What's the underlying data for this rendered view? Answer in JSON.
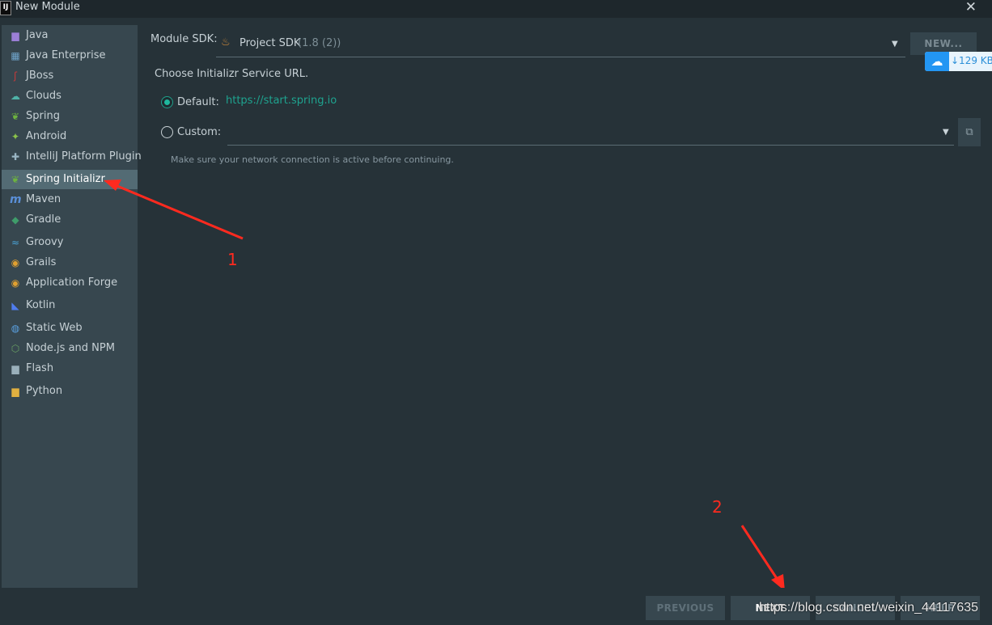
{
  "window": {
    "title": "New Module",
    "close_glyph": "✕",
    "app_icon_letter": "IJ"
  },
  "sidebar": {
    "items": [
      {
        "label": "Java",
        "icon": "folder-icon",
        "color": "#9b7fd6"
      },
      {
        "label": "Java Enterprise",
        "icon": "grid-icon",
        "color": "#6fa3c9"
      },
      {
        "label": "JBoss",
        "icon": "jboss-icon",
        "color": "#c83a3a"
      },
      {
        "label": "Clouds",
        "icon": "cloud-icon",
        "color": "#4fb3a8"
      },
      {
        "label": "Spring",
        "icon": "leaf-icon",
        "color": "#6db33f"
      },
      {
        "label": "Android",
        "icon": "android-icon",
        "color": "#8bc34a"
      },
      {
        "label": "IntelliJ Platform Plugin",
        "icon": "puzzle-icon",
        "color": "#9ab6c4"
      },
      {
        "label": "Spring Initializr",
        "icon": "spring-initializr-icon",
        "color": "#6db33f",
        "selected": true
      },
      {
        "label": "Maven",
        "icon": "maven-icon",
        "color": "#5a8fd8"
      },
      {
        "label": "Gradle",
        "icon": "gradle-icon",
        "color": "#3f9c6a"
      },
      {
        "label": "Groovy",
        "icon": "groovy-icon",
        "color": "#4aa3d6"
      },
      {
        "label": "Grails",
        "icon": "grails-icon",
        "color": "#e0a030"
      },
      {
        "label": "Application Forge",
        "icon": "forge-icon",
        "color": "#e0a030"
      },
      {
        "label": "Kotlin",
        "icon": "kotlin-icon",
        "color": "#4f7df0"
      },
      {
        "label": "Static Web",
        "icon": "globe-icon",
        "color": "#5aa0e0"
      },
      {
        "label": "Node.js and NPM",
        "icon": "nodejs-icon",
        "color": "#68a063"
      },
      {
        "label": "Flash",
        "icon": "flash-icon",
        "color": "#9ab0bb"
      },
      {
        "label": "Python",
        "icon": "python-folder-icon",
        "color": "#e0b040"
      }
    ]
  },
  "sdk": {
    "label": "Module SDK:",
    "name": "Project SDK",
    "version": "(1.8 (2))",
    "new_button": "NEW..."
  },
  "net_badge": {
    "text": "↓129 KB"
  },
  "service": {
    "heading": "Choose Initializr Service URL.",
    "default_label": "Default:",
    "default_url": "https://start.spring.io",
    "custom_label": "Custom:",
    "custom_value": "",
    "hint": "Make sure your network connection is active before continuing."
  },
  "annotations": {
    "step1": "1",
    "step2": "2"
  },
  "footer": {
    "previous": "PREVIOUS",
    "next": "NEXT",
    "cancel": "CANCEL",
    "help": "HELP"
  },
  "watermark": "https://blog.csdn.net/weixin_44117635"
}
